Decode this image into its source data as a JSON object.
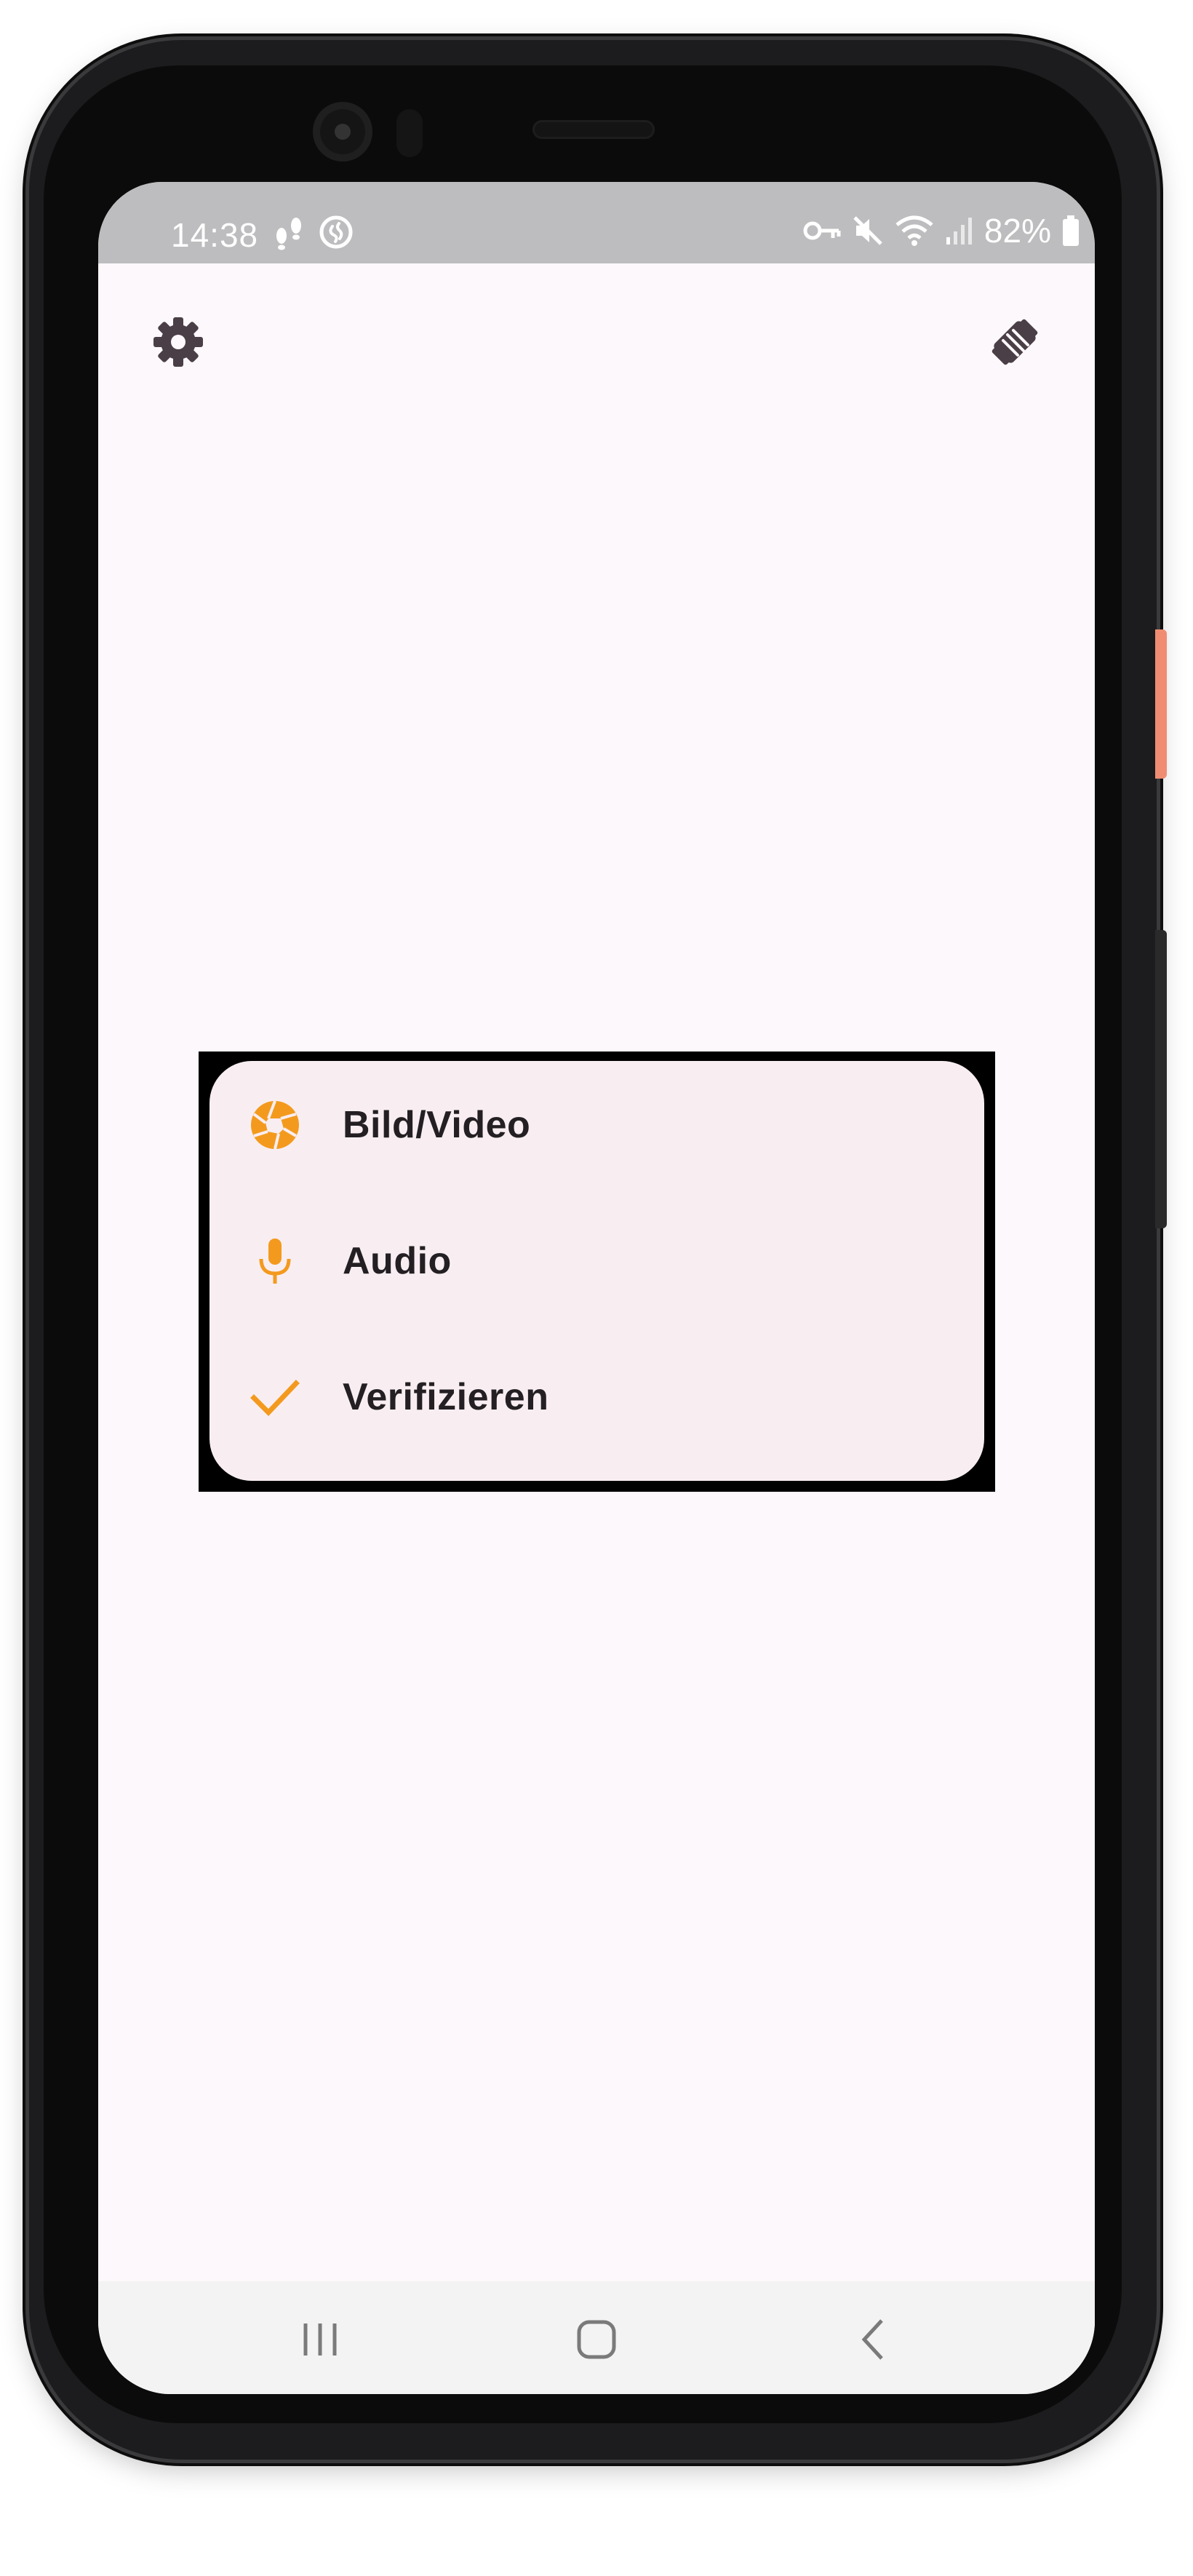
{
  "status_bar": {
    "time": "14:38",
    "battery": "82%",
    "left_icons": [
      "footsteps-icon",
      "shazam-icon"
    ],
    "right_icons": [
      "vpn-key-icon",
      "mute-icon",
      "wifi-icon",
      "signal-icon",
      "battery-icon"
    ]
  },
  "top_bar": {
    "left_icon": "settings-gear-icon",
    "right_icon": "handshake-icon"
  },
  "menu": {
    "items": [
      {
        "label": "Bild/Video",
        "icon": "camera-shutter-icon"
      },
      {
        "label": "Audio",
        "icon": "microphone-icon"
      },
      {
        "label": "Verifizieren",
        "icon": "checkmark-icon"
      }
    ],
    "accent_color": "#f39a1e"
  },
  "nav_bar": {
    "buttons": [
      "recents-icon",
      "home-icon",
      "back-icon"
    ]
  }
}
